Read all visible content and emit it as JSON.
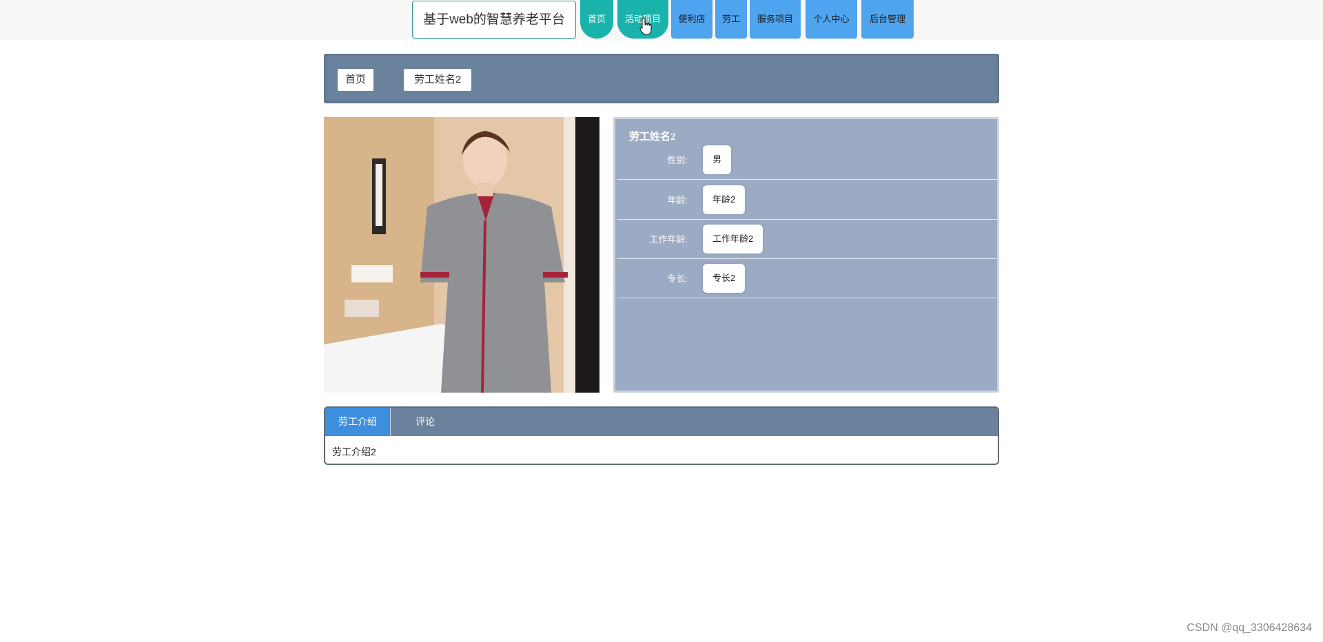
{
  "header": {
    "brand": "基于web的智慧养老平台",
    "nav": [
      {
        "label": "首页"
      },
      {
        "label": "活动项目"
      },
      {
        "label": "便利店"
      },
      {
        "label": "劳工"
      },
      {
        "label": "服务项目"
      },
      {
        "label": "个人中心"
      },
      {
        "label": "后台管理"
      }
    ]
  },
  "breadcrumb": [
    "首页",
    "劳工姓名2"
  ],
  "worker": {
    "name": "劳工姓名2",
    "fields": [
      {
        "label": "性别:",
        "value": "男"
      },
      {
        "label": "年龄:",
        "value": "年龄2"
      },
      {
        "label": "工作年龄:",
        "value": "工作年龄2"
      },
      {
        "label": "专长:",
        "value": "专长2"
      }
    ]
  },
  "tabs": {
    "items": [
      {
        "label": "劳工介绍"
      },
      {
        "label": "评论"
      }
    ],
    "content": "劳工介绍2"
  },
  "watermark": "CSDN @qq_3306428634",
  "colors": {
    "nav_teal": "#19b3ab",
    "nav_blue": "#4fa4ef",
    "panel_bg": "#9aabc3",
    "bar_bg": "#6b829d",
    "tab_active": "#3e8ede"
  }
}
